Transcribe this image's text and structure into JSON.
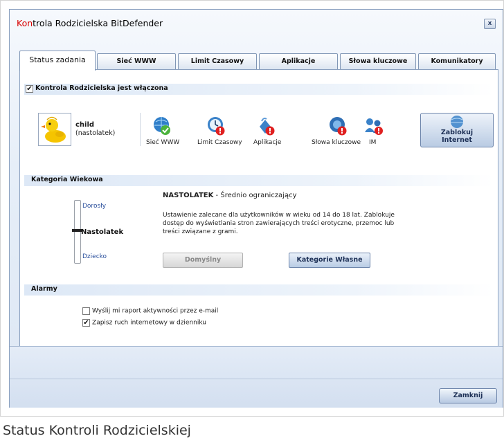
{
  "window": {
    "title_red": "Kon",
    "title_rest": "trola Rodzicielska BitDefender",
    "close_glyph": "x"
  },
  "tabs": [
    {
      "label": "Status zadania",
      "active": true
    },
    {
      "label": "Sieć WWW"
    },
    {
      "label": "Limit Czasowy"
    },
    {
      "label": "Aplikacje"
    },
    {
      "label": "Słowa kluczowe"
    },
    {
      "label": "Komunikatory"
    }
  ],
  "status": {
    "checkbox_label": "Kontrola Rodzicielska jest włączona",
    "checked": true,
    "user_name": "child",
    "user_role": "(nastolatek)",
    "features": [
      {
        "label": "Sieć WWW",
        "icon": "globe-check-icon"
      },
      {
        "label": "Limit Czasowy",
        "icon": "clock-warning-icon"
      },
      {
        "label": "Aplikacje",
        "icon": "applications-warning-icon"
      },
      {
        "label": "Słowa kluczowe",
        "icon": "keywords-warning-icon"
      },
      {
        "label": "IM",
        "icon": "instant-messenger-icon"
      }
    ],
    "block_button_line1": "Zablokuj",
    "block_button_line2": "Internet"
  },
  "age": {
    "header": "Kategoria Wiekowa",
    "levels": [
      "Dorosły",
      "Nastolatek",
      "Dziecko"
    ],
    "selected": "Nastolatek",
    "selected_title": "NASTOLATEK",
    "selected_subtitle": " - Średnio ograniczający",
    "description_line1": "Ustawienie zalecane dla użytkowników w wieku od 14 do 18 lat. Zablokuje",
    "description_line2": "dostęp do wyświetlania stron zawierających treści erotyczne, przemoc lub",
    "description_line3": "treści związane z grami.",
    "default_button": "Domyślny",
    "custom_button": "Kategorie Własne"
  },
  "alarms": {
    "header": "Alarmy",
    "options": [
      {
        "label": "Wyślij mi raport aktywności przez e-mail",
        "checked": false
      },
      {
        "label": "Zapisz ruch internetowy w dzienniku",
        "checked": true
      }
    ]
  },
  "footer": {
    "close_button": "Zamknij"
  },
  "caption": "Status Kontroli Rodzicielskiej",
  "colors": {
    "title_accent": "#d80000",
    "section_bar": "#dde8f6",
    "button_text": "#1e3157"
  }
}
